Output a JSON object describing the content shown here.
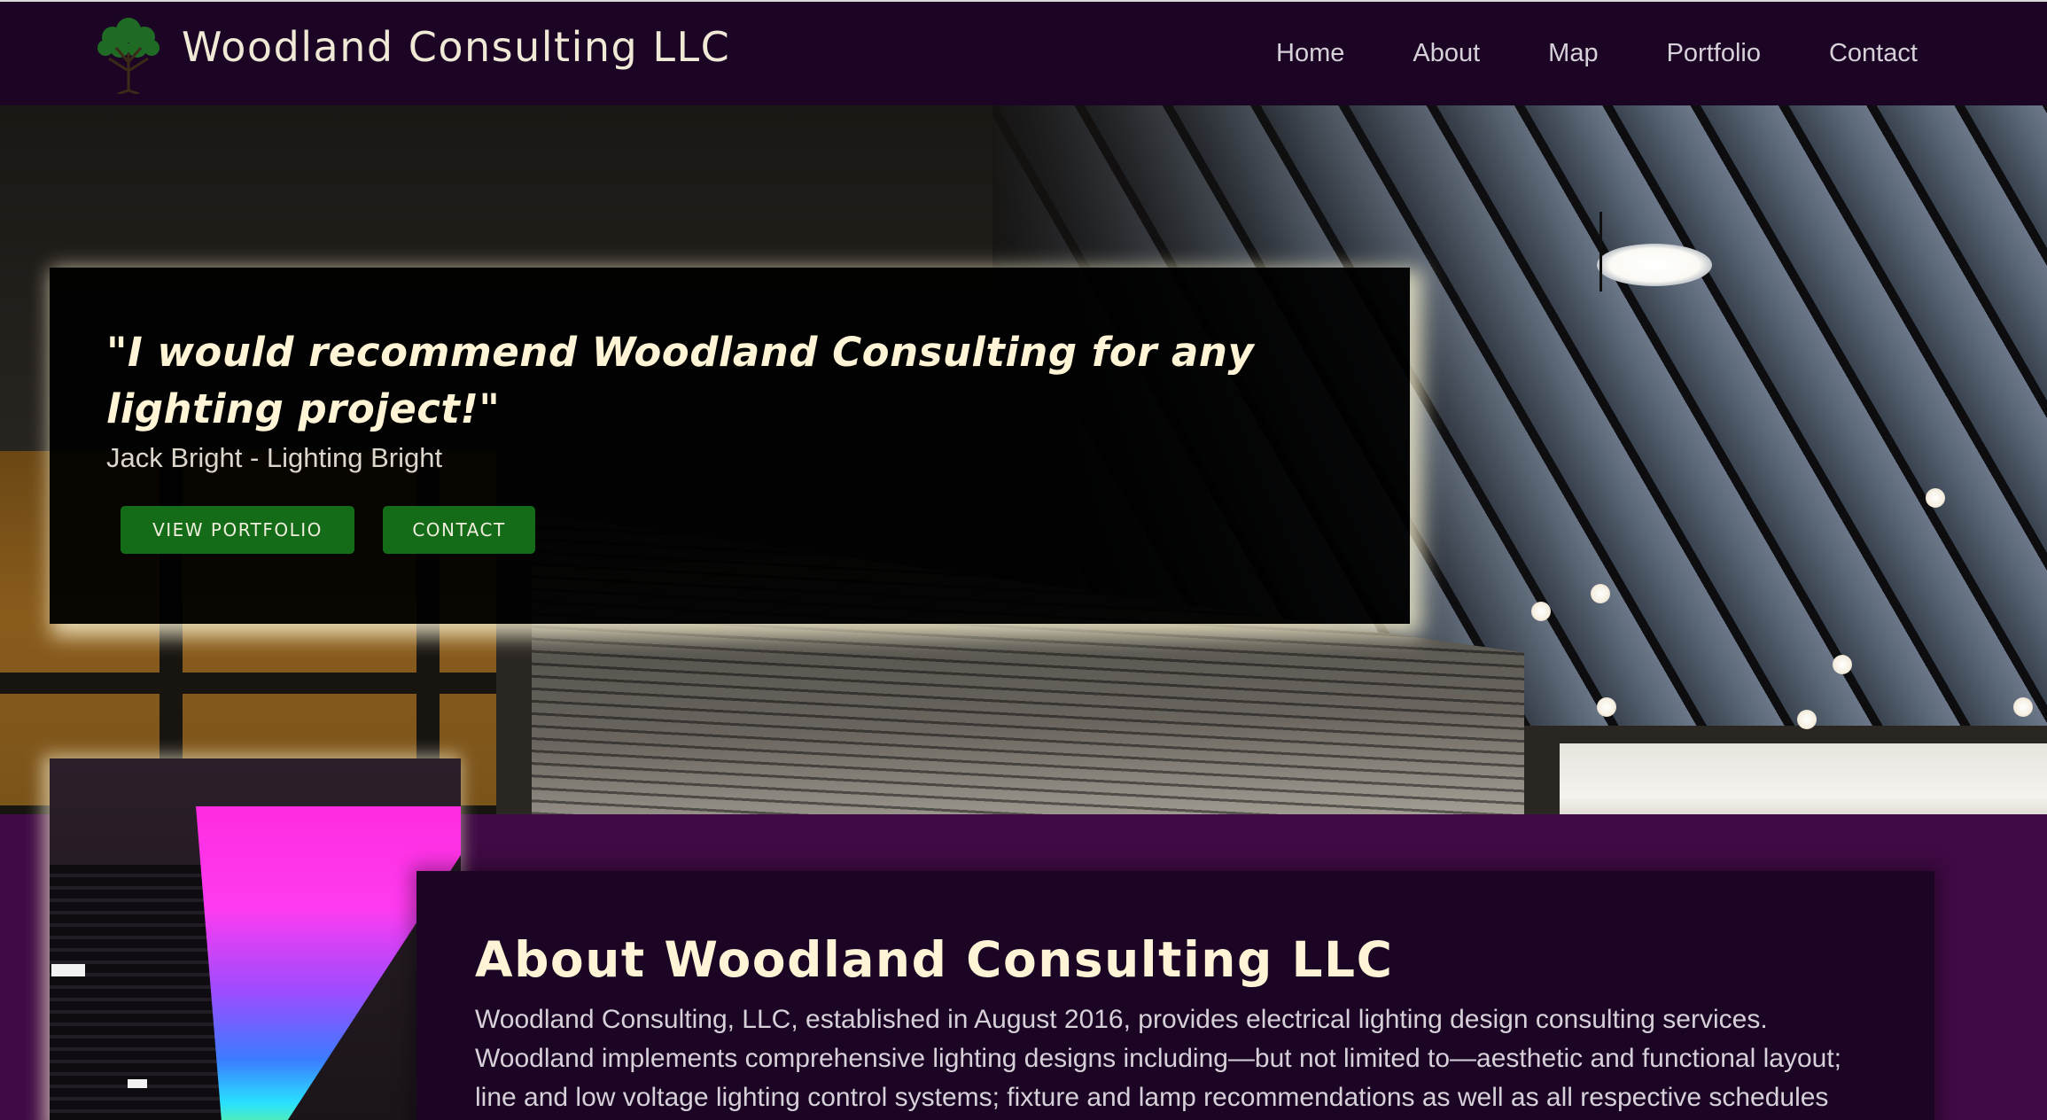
{
  "header": {
    "brand_title": "Woodland Consulting LLC",
    "logo_icon": "tree-logo-icon",
    "nav": [
      {
        "label": "Home"
      },
      {
        "label": "About"
      },
      {
        "label": "Map"
      },
      {
        "label": "Portfolio"
      },
      {
        "label": "Contact"
      }
    ]
  },
  "hero": {
    "quote": "\"I would recommend Woodland Consulting for any lighting project!\"",
    "author": "Jack Bright - Lighting Bright",
    "buttons": {
      "portfolio": "VIEW PORTFOLIO",
      "contact": "CONTACT"
    }
  },
  "about": {
    "title": "About Woodland Consulting LLC",
    "lines": [
      "Woodland Consulting, LLC, established in August 2016, provides electrical lighting design consulting services.",
      "Woodland implements comprehensive lighting designs including—but not limited to—aesthetic and functional layout;",
      "line and low voltage lighting control systems; fixture and lamp recommendations as well as all respective schedules"
    ]
  },
  "colors": {
    "navbar_bg": "#1c0425",
    "section_bg": "#400a45",
    "button_bg": "#146b18",
    "heading_text": "#fff5d6"
  }
}
